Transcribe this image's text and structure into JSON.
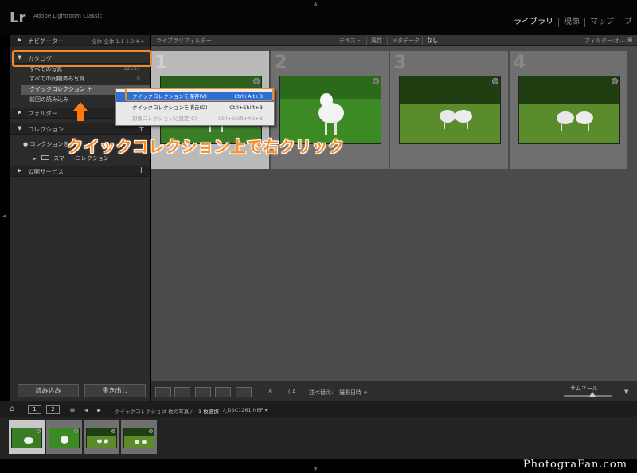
{
  "app": {
    "logo": "Lr",
    "name": "Adobe Lightroom Classic"
  },
  "modules": [
    "ライブラリ",
    "現像",
    "マップ",
    "ブ"
  ],
  "left_panel": {
    "navigator": {
      "title": "ナビゲーター",
      "zoom_options": "全体  全体  1:1  1:3.4 ≑"
    },
    "catalog": {
      "title": "カタログ",
      "items": [
        {
          "label": "すべての写真",
          "count": "22537"
        },
        {
          "label": "すべての同期済み写真",
          "count": "0"
        },
        {
          "label": "クイックコレクション ＋",
          "count": ""
        },
        {
          "label": "前回の読み込み",
          "count": ""
        }
      ]
    },
    "folders": {
      "title": "フォルダー"
    },
    "collections": {
      "title": "コレクション",
      "filter_label": "コレクションを",
      "smart_collection": "スマートコレクション"
    },
    "publish": {
      "title": "公開サービス"
    },
    "import_button": "読み込み",
    "export_button": "書き出し"
  },
  "filter_bar": {
    "title": "ライブラリフィルター",
    "items": [
      "テキスト",
      "属性",
      "メタデータ",
      "なし"
    ],
    "active": "なし",
    "filter_preset": "フィルター:オ…"
  },
  "grid": {
    "cells": [
      {
        "number": "1",
        "selected": true
      },
      {
        "number": "2",
        "selected": false
      },
      {
        "number": "3",
        "selected": false
      },
      {
        "number": "4",
        "selected": false
      }
    ]
  },
  "context_menu": {
    "items": [
      {
        "label": "クイックコレクションを保存(V)",
        "shortcut": "Ctrl+Alt+B",
        "state": "highlighted"
      },
      {
        "label": "クイックコレクションを消去(D)",
        "shortcut": "Ctrl+Shift+B",
        "state": "normal"
      },
      {
        "label": "対象コレクションに設定(C)",
        "shortcut": "Ctrl+Shift+Alt+B",
        "state": "disabled"
      }
    ]
  },
  "annotation": "クイックコレクション上で右クリック",
  "toolbar": {
    "sort_label": "並べ替え:",
    "sort_value": "撮影日時 ≑",
    "thumbnail_label": "サムネール"
  },
  "status_bar": {
    "page1": "1",
    "page2": "2",
    "source": "クイックコレクション",
    "count": "4 枚の写真 /",
    "selected": "1 枚選択",
    "filename": "/_DSC1261.NEF ▾"
  },
  "filmstrip": {
    "count": 4,
    "selected_index": 0
  },
  "watermark": "PhotograFan.com",
  "colors": {
    "annotation": "#ff8a1e",
    "highlight_box": "#f08a2a",
    "menu_highlight": "#2f6fd0"
  }
}
